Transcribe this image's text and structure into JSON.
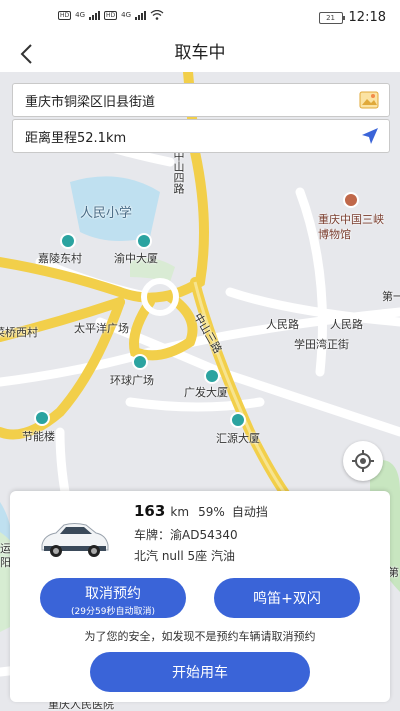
{
  "status": {
    "left_items": [
      "HD",
      "4G",
      "HD",
      "4G"
    ],
    "battery": "21",
    "time": "12:18"
  },
  "nav": {
    "title": "取车中"
  },
  "address": {
    "location": "重庆市铜梁区旧县街道",
    "distance": "距离里程52.1km"
  },
  "map": {
    "labels": {
      "zhongshan_si": "中山四路",
      "chongqing_museum": "重庆中国三峡博物馆",
      "renmin_school": "人民小学",
      "jialing_village": "嘉陵东村",
      "yuzhong_building": "渝中大厦",
      "qiaoxi_village": "菜桥西村",
      "taipingyang": "太平洋广场",
      "huanqiu": "环球广场",
      "renmin_road": "人民路",
      "renmin_road2": "人民路",
      "xuetianwan": "学田湾正街",
      "guangfa": "广发大厦",
      "jielou": "节能楼",
      "huiyuan": "汇源大厦",
      "zhongshan_san": "中山三路",
      "edge_right": "第一",
      "edge_right2": "第",
      "edge_left": "运",
      "edge_left2": "阳",
      "bottom_cut": "重庆人民医院"
    }
  },
  "vehicle": {
    "range_value": "163",
    "range_unit": "km",
    "battery_pct": "59%",
    "transmission": "自动挡",
    "plate": "车牌：渝AD54340",
    "model": "北汽 null 5座 汽油"
  },
  "actions": {
    "cancel_label": "取消预约",
    "cancel_sub": "(29分59秒自动取消)",
    "honk_label": "鸣笛+双闪",
    "safety_notice": "为了您的安全，如发现不是预约车辆请取消预约",
    "start_label": "开始用车"
  },
  "colors": {
    "accent": "#3a64d8",
    "road_yellow": "#f2cf4a",
    "water": "#bfe0f0",
    "green": "#c8e6c0"
  }
}
